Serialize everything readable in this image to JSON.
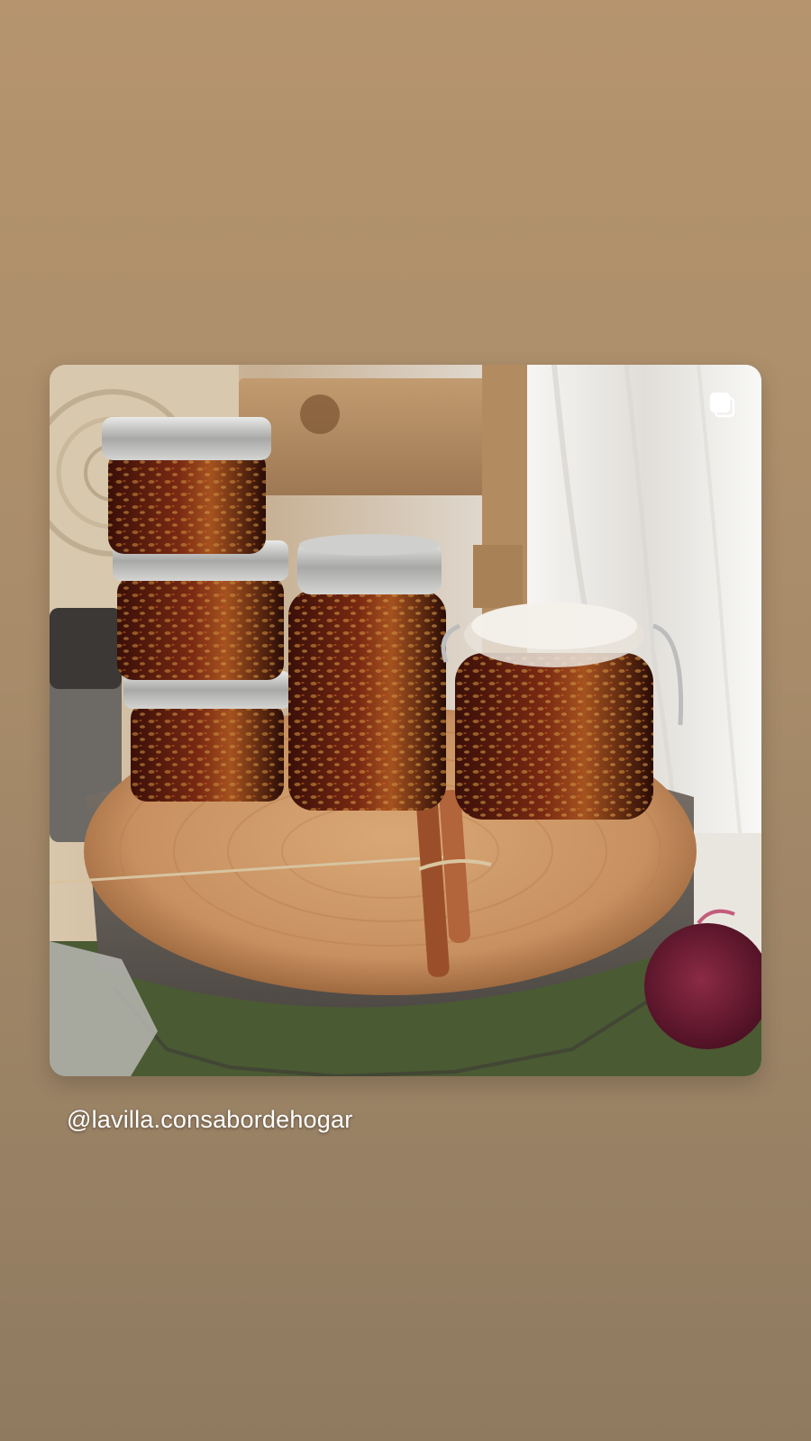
{
  "story": {
    "username": "@lavilla.consabordehogar"
  },
  "post": {
    "image_subject": "jars of preserved nuts and seeds on a wooden log slice with cinnamon sticks",
    "overlay_icon": "multiple-photos-icon"
  }
}
